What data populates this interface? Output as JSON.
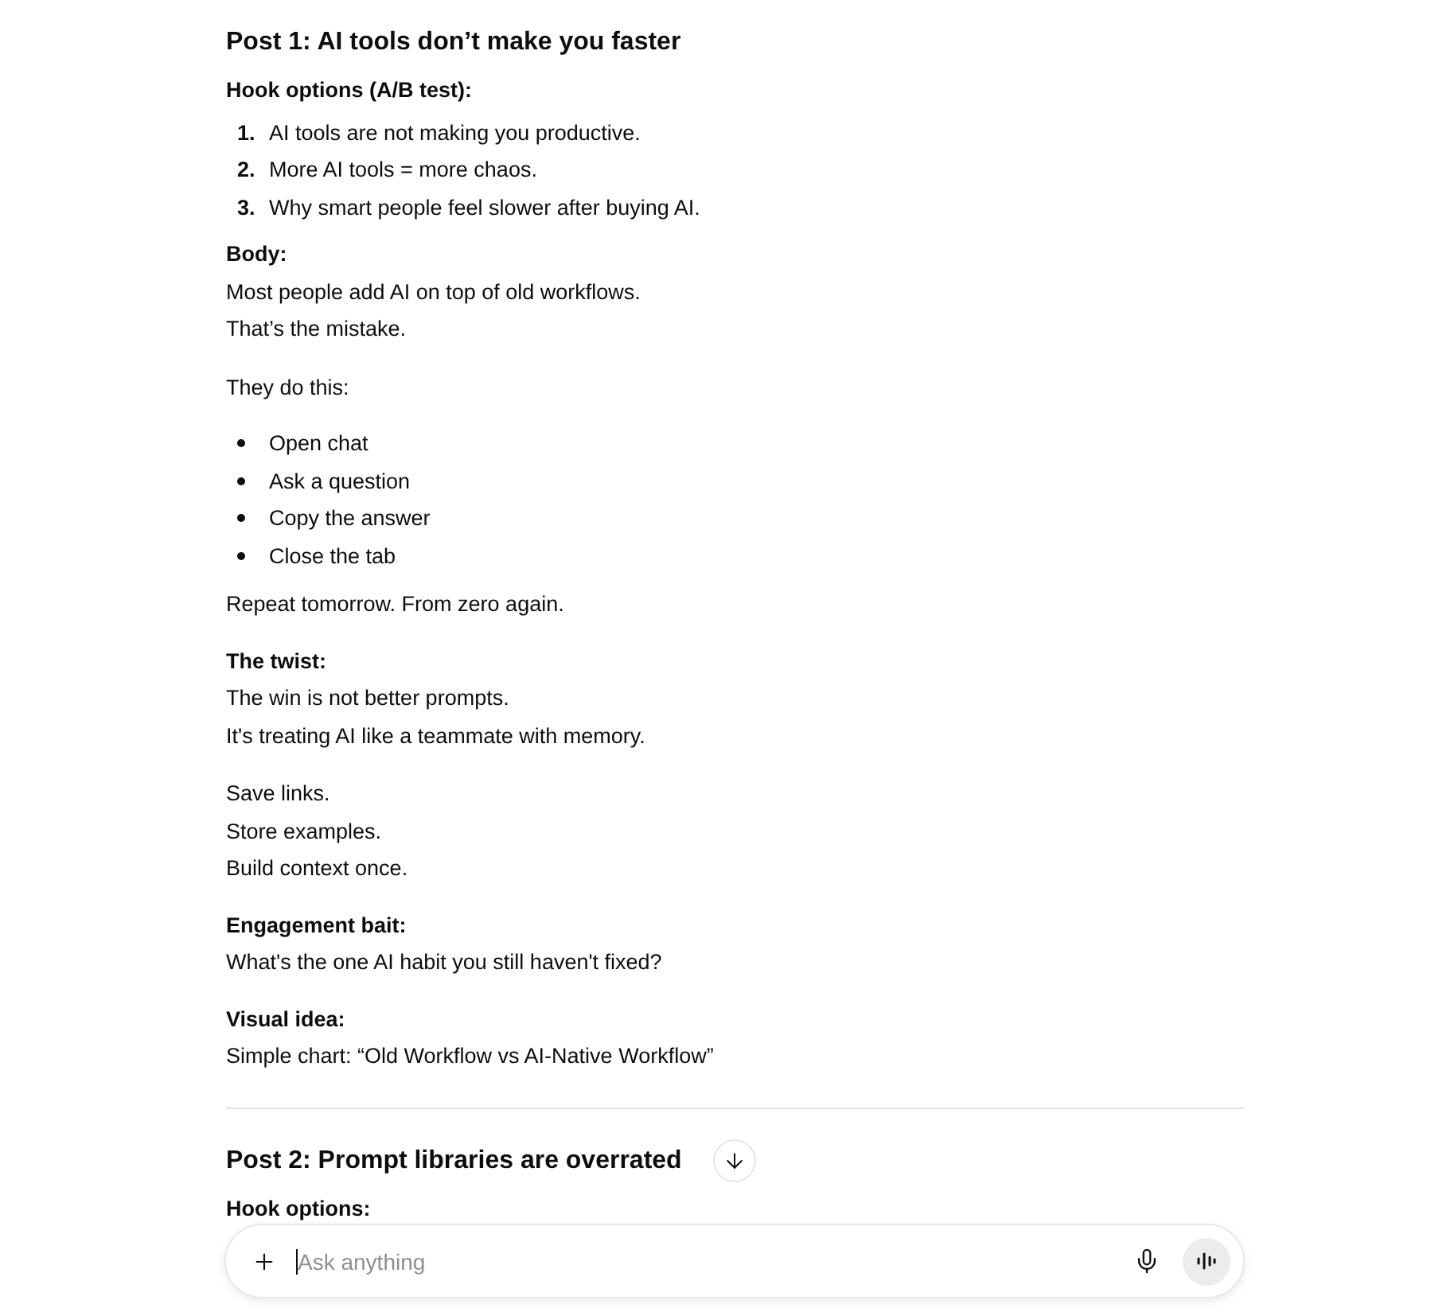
{
  "posts": [
    {
      "title": "Post 1: AI tools don’t make you faster",
      "blocks": [
        {
          "kind": "label",
          "text": "Hook options (A/B test):"
        },
        {
          "kind": "numbered",
          "items": [
            {
              "number": "1.",
              "text": "AI tools are not making you productive."
            },
            {
              "number": "2.",
              "text": "More AI tools = more chaos."
            },
            {
              "number": "3.",
              "text": "Why smart people feel slower after buying AI."
            }
          ]
        },
        {
          "kind": "label",
          "text": "Body:"
        },
        {
          "kind": "lines",
          "lines": [
            "Most people add AI on top of old workflows.",
            "That’s the mistake."
          ]
        },
        {
          "kind": "lines",
          "lines": [
            "They do this:"
          ]
        },
        {
          "kind": "bullets",
          "items": [
            "Open chat",
            "Ask a question",
            "Copy the answer",
            "Close the tab"
          ]
        },
        {
          "kind": "lines",
          "lines": [
            "Repeat tomorrow. From zero again."
          ]
        },
        {
          "kind": "label",
          "text": "The twist:"
        },
        {
          "kind": "lines",
          "lines": [
            "The win is not better prompts.",
            "It's treating AI like a teammate with memory."
          ]
        },
        {
          "kind": "lines",
          "lines": [
            "Save links.",
            "Store examples.",
            "Build context once."
          ]
        },
        {
          "kind": "label",
          "text": "Engagement bait:"
        },
        {
          "kind": "lines",
          "lines": [
            "What's the one AI habit you still haven't fixed?"
          ]
        },
        {
          "kind": "label",
          "text": "Visual idea:"
        },
        {
          "kind": "lines",
          "lines": [
            "Simple chart: “Old Workflow vs AI-Native Workflow”"
          ]
        }
      ]
    },
    {
      "title": "Post 2: Prompt libraries are overrated",
      "blocks": [
        {
          "kind": "label",
          "text": "Hook options:"
        }
      ]
    }
  ],
  "composer": {
    "placeholder": "Ask anything"
  }
}
